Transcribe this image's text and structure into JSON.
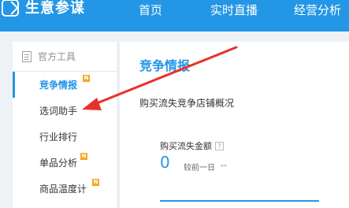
{
  "brand": {
    "name": "生意参谋"
  },
  "nav": {
    "home": "首页",
    "live": "实时直播",
    "ops": "经营分析"
  },
  "sidebar": {
    "header": "官方工具",
    "items": [
      {
        "label": "竞争情报",
        "badge": "N"
      },
      {
        "label": "选词助手",
        "badge": ""
      },
      {
        "label": "行业排行",
        "badge": ""
      },
      {
        "label": "单品分析",
        "badge": "N"
      },
      {
        "label": "商品温度计",
        "badge": "N"
      }
    ]
  },
  "main": {
    "title": "竞争情报",
    "subtitle": "购买流失竞争店铺概况",
    "stat": {
      "label": "购买流失金额",
      "help": "?",
      "value": "0",
      "compare_label": "较前一日",
      "change": "--"
    }
  },
  "colors": {
    "accent": "#2396e6",
    "badge": "#f6a623",
    "arrow": "#e8322b"
  }
}
